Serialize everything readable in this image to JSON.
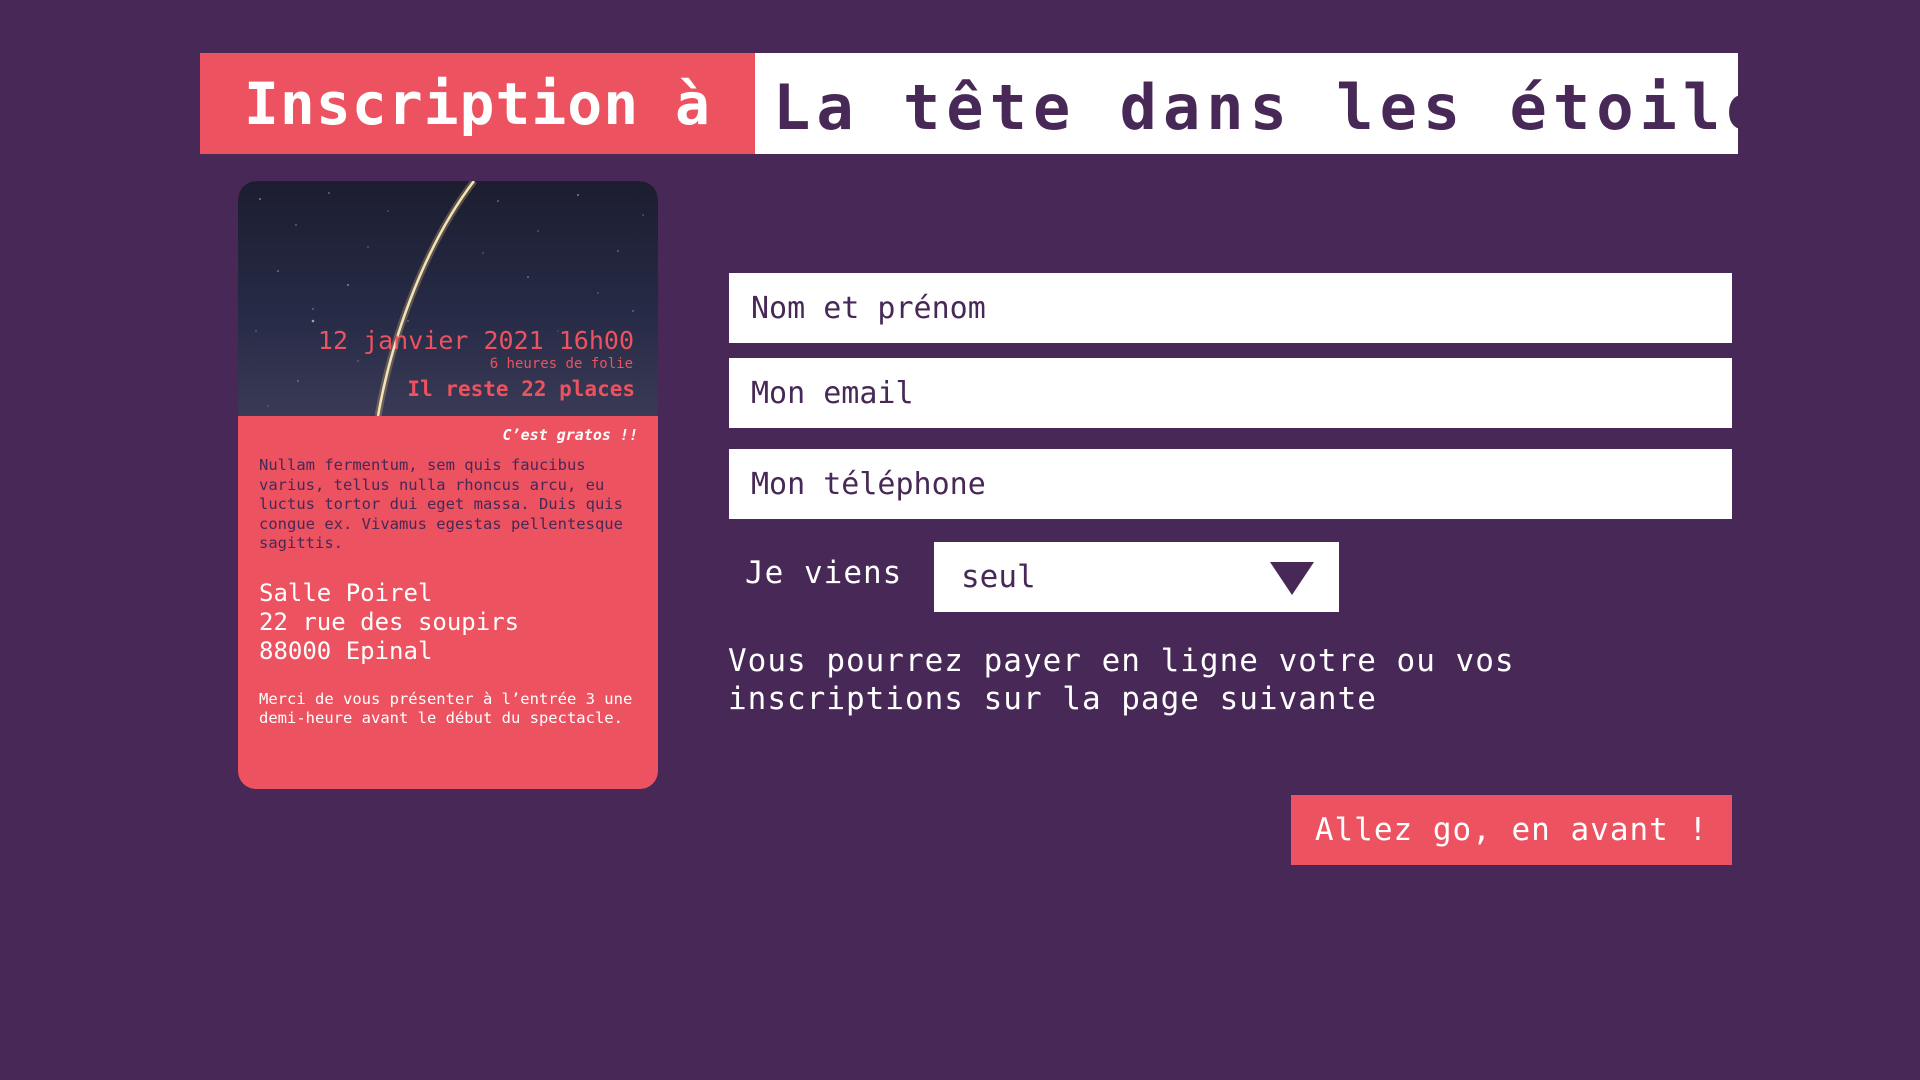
{
  "header": {
    "prefix": "Inscription à",
    "event_title": "La tête dans les étoiles"
  },
  "card": {
    "date": "12 janvier 2021 16h00",
    "duration": "6 heures de folie",
    "places": "Il reste 22 places",
    "free": "C’est gratos !!",
    "description": "Nullam fermentum, sem quis faucibus varius, tellus nulla rhoncus arcu, eu luctus tortor dui eget massa. Duis quis congue ex. Vivamus egestas pellentesque sagittis.",
    "address": {
      "venue": "Salle Poirel",
      "street": "22 rue des soupirs",
      "city": "88000 Epinal"
    },
    "note": "Merci de vous présenter à l’entrée 3 une demi-heure avant le début du spectacle."
  },
  "form": {
    "name_placeholder": "Nom et prénom",
    "email_placeholder": "Mon email",
    "phone_placeholder": "Mon téléphone",
    "attendance_label": "Je viens",
    "attendance_value": "seul",
    "payment_line1": "Vous pourrez payer en ligne votre ou vos",
    "payment_line2": "inscriptions sur la page suivante",
    "submit_label": "Allez go, en avant !"
  },
  "colors": {
    "background": "#472856",
    "accent": "#ec525f",
    "field": "#ffffff"
  }
}
